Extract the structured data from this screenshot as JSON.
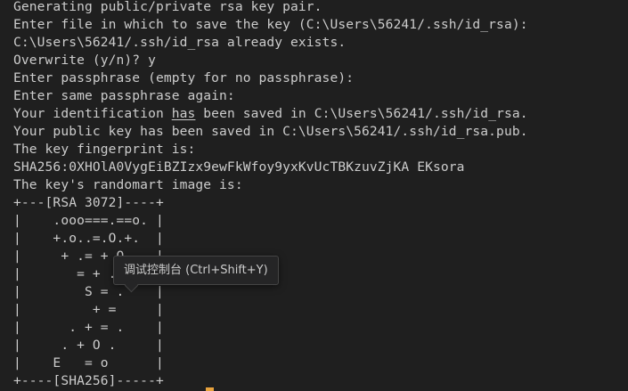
{
  "terminal": {
    "lines": [
      "Generating public/private rsa key pair.",
      "Enter file in which to save the key (C:\\Users\\56241/.ssh/id_rsa):",
      "C:\\Users\\56241/.ssh/id_rsa already exists.",
      "Overwrite (y/n)? y",
      "Enter passphrase (empty for no passphrase):",
      "Enter same passphrase again:",
      "Your identification ",
      "Your public key has been saved in C:\\Users\\56241/.ssh/id_rsa.pub.",
      "The key fingerprint is:",
      "SHA256:0XHOlA0VygEiBZIzx9ewFkWfoy9yxKvUcTBKzuvZjKA EKsora",
      "The key's randomart image is:",
      "+---[RSA 3072]----+",
      "|    .ooo===.==o. |",
      "|    +.o..=.O.+.  |",
      "|     + .= + O    |",
      "|       = + .     |",
      "|        S = .    |",
      "|         + =     |",
      "|      . + = .    |",
      "|     . + O .     |",
      "|    E   = o      |",
      "+----[SHA256]-----+"
    ],
    "line7_highlight": "has",
    "line7_rest": " been saved in C:\\Users\\56241/.ssh/id_rsa."
  },
  "tooltip": {
    "text": "调试控制台 (Ctrl+Shift+Y)"
  },
  "colors": {
    "background": "#1f1f1f",
    "text": "#cccccc",
    "cursor": "#e8a33d"
  }
}
